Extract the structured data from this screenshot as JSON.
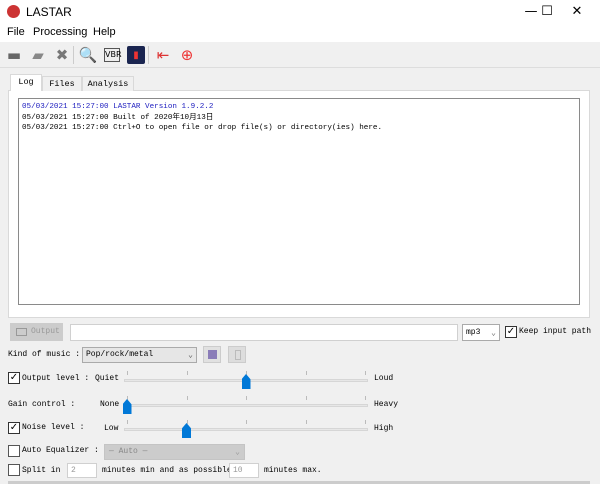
{
  "window": {
    "title": "LASTAR",
    "minimize": "—",
    "maximize": "☐",
    "close": "✕"
  },
  "menu": [
    "File",
    "Processing",
    "Help"
  ],
  "toolbar": [
    "open-file-icon",
    "open-folder-icon",
    "close-icon",
    "search-icon",
    "vbr-icon",
    "spectrum-icon",
    "exit-icon",
    "help-lifebuoy-icon"
  ],
  "tabs": [
    "Log",
    "Files",
    "Analysis"
  ],
  "log": [
    {
      "text": "05/03/2021 15:27:00 LASTAR Version 1.9.2.2",
      "color": "#2020c0"
    },
    {
      "text": "05/03/2021 15:27:00 Built of 2020年10月13日",
      "color": "#000000"
    },
    {
      "text": "05/03/2021 15:27:00 Ctrl+O to open file or drop file(s) or directory(ies) here.",
      "color": "#000000"
    }
  ],
  "output": {
    "button": "Output",
    "path": "",
    "format": "mp3",
    "keep_input_path": "Keep input path",
    "keep_checked": true
  },
  "kind_of_music": {
    "label": "Kind of music :",
    "value": "Pop/rock/metal"
  },
  "output_level": {
    "label": "Output level :",
    "low": "Quiet",
    "high": "Loud",
    "checked": true,
    "value": 0.5
  },
  "gain_control": {
    "label": "Gain control :",
    "low": "None",
    "high": "Heavy",
    "value": 0
  },
  "noise_level": {
    "label": "Noise level :",
    "low": "Low",
    "high": "High",
    "checked": true,
    "value": 0.25
  },
  "auto_equalizer": {
    "label": "Auto Equalizer :",
    "value": "— Auto —",
    "checked": false
  },
  "split": {
    "label": "Split in",
    "min": "2",
    "mid": "minutes min and as possible",
    "max": "10",
    "end": "minutes max.",
    "checked": false
  }
}
